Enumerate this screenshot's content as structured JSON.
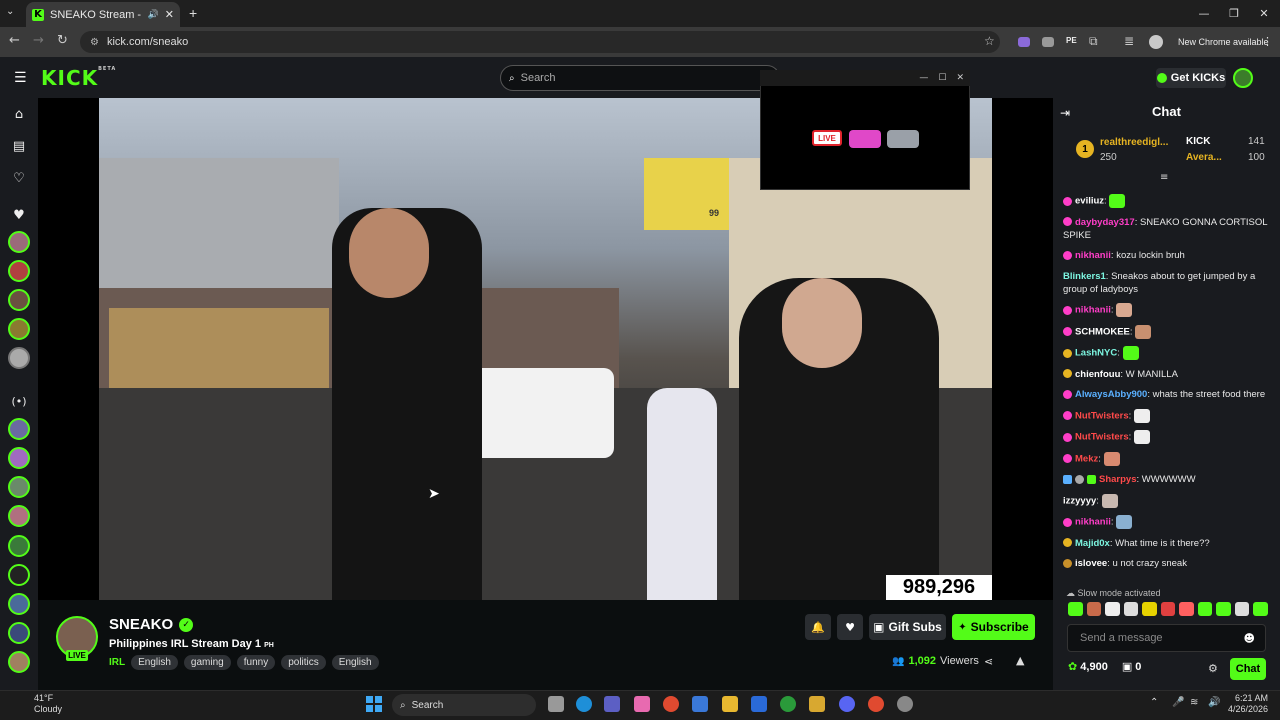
{
  "browser": {
    "tab_title": "SNEAKO Stream - Watch Liv",
    "url": "kick.com/sneako",
    "new_chrome": "New Chrome available",
    "new_tab": "+"
  },
  "header": {
    "logo": "KICK",
    "logo_badge": "BETA",
    "search_placeholder": "Search",
    "get_kicks": "Get KICKs"
  },
  "player": {
    "viewer_overlay": "989,296",
    "billboard_number": "99"
  },
  "stream": {
    "streamer": "SNEAKO",
    "live": "LIVE",
    "title": "Philippines IRL Stream Day 1",
    "title_suffix": "PH",
    "category": "IRL",
    "tags": [
      "English",
      "gaming",
      "funny",
      "politics",
      "English"
    ],
    "viewers_count": "1,092",
    "viewers_label": "Viewers",
    "gift_subs": "Gift Subs",
    "subscribe": "Subscribe"
  },
  "chat": {
    "title": "Chat",
    "leaderboard": {
      "rank": "1",
      "top_user": "realthreedigl...",
      "top_points": "250",
      "right_1_name": "KICK",
      "right_1_value": "141",
      "right_2_name": "Avera...",
      "right_2_value": "100"
    },
    "messages": [
      {
        "user": "eviliuz",
        "color": "#ffffff",
        "text": ""
      },
      {
        "user": "daybyday317",
        "color": "#ff3ec8",
        "text": "SNEAKO GONNA CORTISOL SPIKE"
      },
      {
        "user": "nikhanii",
        "color": "#ff3ec8",
        "text": "kozu lockin bruh"
      },
      {
        "user": "Blinkers1",
        "color": "#7cf5e0",
        "text": "Sneakos about to get jumped by a group of ladyboys"
      },
      {
        "user": "nikhanii",
        "color": "#ff3ec8",
        "text": ""
      },
      {
        "user": "SCHMOKEE",
        "color": "#ffffff",
        "text": ""
      },
      {
        "user": "LashNYC",
        "color": "#7cf5e0",
        "text": ""
      },
      {
        "user": "chienfouu",
        "color": "#ffffff",
        "text": "W MANILLA"
      },
      {
        "user": "AlwaysAbby900",
        "color": "#5ab0ff",
        "text": "whats the street food there"
      },
      {
        "user": "NutTwisters",
        "color": "#ff4a4a",
        "text": ""
      },
      {
        "user": "NutTwisters",
        "color": "#ff4a4a",
        "text": ""
      },
      {
        "user": "Mekz",
        "color": "#ff4a4a",
        "text": ""
      },
      {
        "user": "Sharpys",
        "color": "#ff4a4a",
        "text": "WWWWWW"
      },
      {
        "user": "izzyyyy",
        "color": "#ffffff",
        "text": ""
      },
      {
        "user": "nikhanii",
        "color": "#ff3ec8",
        "text": ""
      },
      {
        "user": "Majid0x",
        "color": "#7cf5e0",
        "text": "What time is it there??"
      },
      {
        "user": "islovee",
        "color": "#ffffff",
        "text": "u not crazy sneak"
      }
    ],
    "slow_mode": "Slow mode activated",
    "input_placeholder": "Send a message",
    "points": "4,900",
    "gifts": "0",
    "send_button": "Chat"
  },
  "taskbar": {
    "temp": "41°F",
    "condition": "Cloudy",
    "search": "Search",
    "time": "6:21 AM",
    "date": "4/26/2026"
  },
  "colors": {
    "accent": "#53fc18",
    "bg": "#0b0e0f",
    "panel": "#191b1f"
  }
}
